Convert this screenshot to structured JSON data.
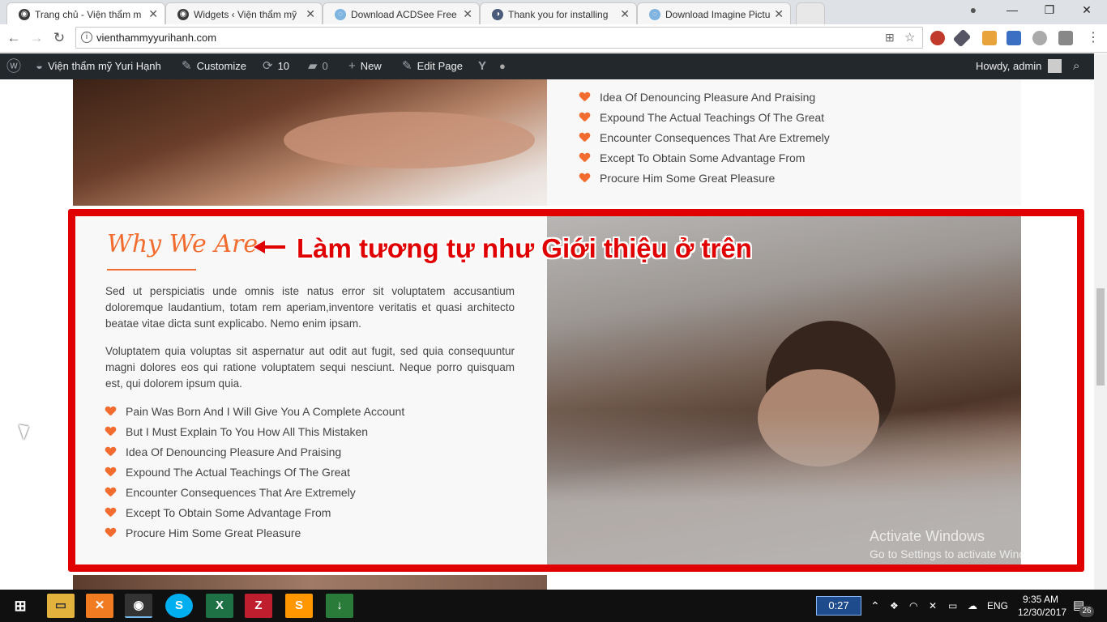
{
  "browser": {
    "tabs": [
      {
        "title": "Trang chủ - Viện thẩm m",
        "active": true
      },
      {
        "title": "Widgets ‹ Viện thẩm mỹ",
        "active": false
      },
      {
        "title": "Download ACDSee Free",
        "active": false
      },
      {
        "title": "Thank you for installing",
        "active": false
      },
      {
        "title": "Download Imagine Pictu",
        "active": false
      }
    ],
    "tab_close": "✕",
    "window_controls": {
      "minimize": "—",
      "restore": "❐",
      "close": "✕"
    },
    "url": "vienthammyyurihanh.com"
  },
  "admin_bar": {
    "site_name": "Viện thẩm mỹ Yuri Hạnh",
    "customize": "Customize",
    "updates_count": "10",
    "comments_count": "0",
    "new_label": "New",
    "edit_page": "Edit Page",
    "howdy": "Howdy, admin"
  },
  "top_list": {
    "items": [
      "Idea Of Denouncing Pleasure And Praising",
      "Expound The Actual Teachings Of The Great",
      "Encounter Consequences That Are Extremely",
      "Except To Obtain Some Advantage From",
      "Procure Him Some Great Pleasure"
    ]
  },
  "section": {
    "title": "Why We Are",
    "annotation": "Làm tương tự như Giới thiệu ở trên",
    "paragraph1": "Sed ut perspiciatis unde omnis iste natus error sit voluptatem accusantium doloremque laudantium, totam rem aperiam,inventore veritatis et quasi architecto beatae vitae dicta sunt explicabo. Nemo enim ipsam.",
    "paragraph2": "Voluptatem quia voluptas sit aspernatur aut odit aut fugit, sed quia consequuntur magni dolores eos qui ratione voluptatem sequi nesciunt. Neque porro quisquam est, qui dolorem ipsum quia.",
    "list": [
      "Pain Was Born And I Will Give You A Complete Account",
      "But I Must Explain To You How All This Mistaken",
      "Idea Of Denouncing Pleasure And Praising",
      "Expound The Actual Teachings Of The Great",
      "Encounter Consequences That Are Extremely",
      "Except To Obtain Some Advantage From",
      "Procure Him Some Great Pleasure"
    ]
  },
  "watermark": {
    "line1": "Activate Windows",
    "line2": "Go to Settings to activate Windows."
  },
  "taskbar": {
    "timer": "0:27",
    "language": "ENG",
    "time": "9:35 AM",
    "date": "12/30/2017",
    "notifications": "26"
  },
  "colors": {
    "accent": "#f26c2f",
    "annotation_red": "#e00000",
    "admin_bar": "#23282d"
  }
}
